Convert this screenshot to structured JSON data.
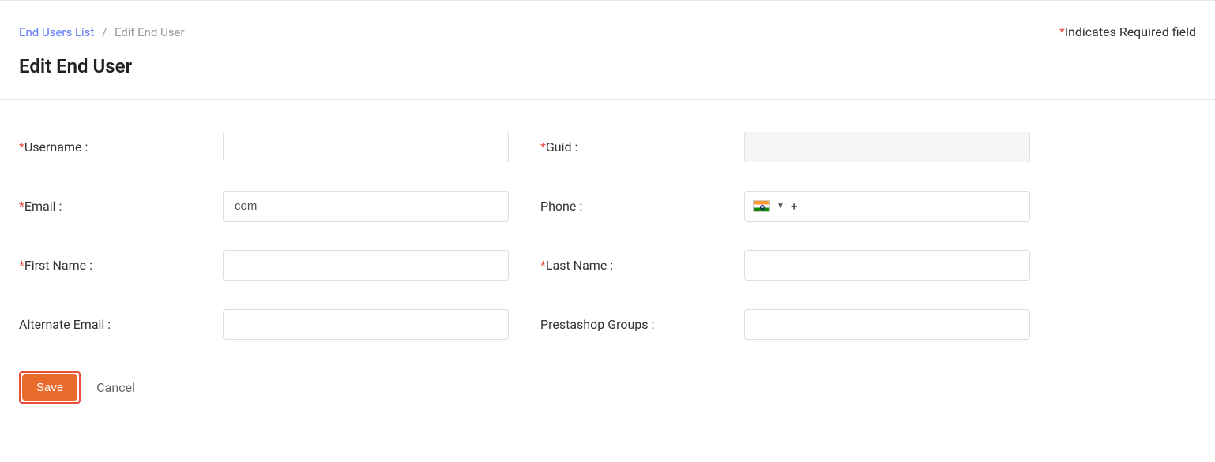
{
  "breadcrumb": {
    "parent": "End Users List",
    "separator": "/",
    "current": "Edit End User"
  },
  "required_note": {
    "star": "*",
    "text": "Indicates Required field"
  },
  "page_title": "Edit End User",
  "phone_prefix": "+",
  "labels": {
    "username": "Username :",
    "guid": "Guid :",
    "email": "Email :",
    "phone": "Phone :",
    "first_name": "First Name :",
    "last_name": "Last Name :",
    "alt_email": "Alternate Email :",
    "presta": "Prestashop Groups :"
  },
  "values": {
    "username": "",
    "guid": "",
    "email": "com",
    "phone": "",
    "first_name": "",
    "last_name": "",
    "alt_email": "",
    "presta": ""
  },
  "actions": {
    "save": "Save",
    "cancel": "Cancel"
  }
}
